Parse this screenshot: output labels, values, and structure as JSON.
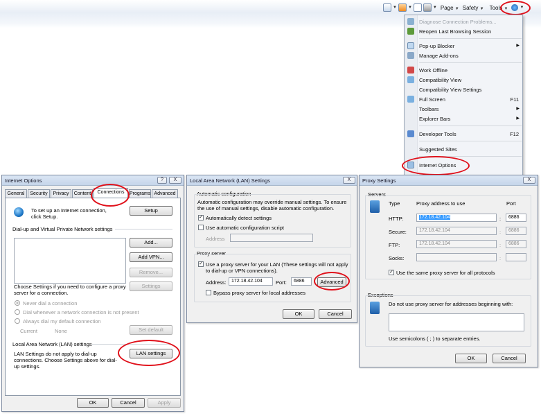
{
  "toolbar": {
    "page_label": "Page",
    "safety_label": "Safety",
    "tools_label": "Tools"
  },
  "tools_menu": {
    "items": [
      {
        "label": "Diagnose Connection Problems...",
        "disabled": true
      },
      {
        "label": "Reopen Last Browsing Session"
      },
      {
        "label": "Pop-up Blocker",
        "submenu": true
      },
      {
        "label": "Manage Add-ons"
      },
      {
        "label": "Work Offline"
      },
      {
        "label": "Compatibility View"
      },
      {
        "label": "Compatibility View Settings"
      },
      {
        "label": "Full Screen",
        "shortcut": "F11"
      },
      {
        "label": "Toolbars",
        "submenu": true
      },
      {
        "label": "Explorer Bars",
        "submenu": true
      },
      {
        "label": "Developer Tools",
        "shortcut": "F12"
      },
      {
        "label": "Suggested Sites"
      },
      {
        "label": "Internet Options"
      }
    ]
  },
  "internet_options": {
    "title": "Internet Options",
    "help_btn": "?",
    "close_btn": "X",
    "tabs": [
      "General",
      "Security",
      "Privacy",
      "Content",
      "Connections",
      "Programs",
      "Advanced"
    ],
    "setup_text": "To set up an Internet connection, click Setup.",
    "setup_button": "Setup",
    "dialup_heading": "Dial-up and Virtual Private Network settings",
    "add_button": "Add...",
    "add_vpn_button": "Add VPN...",
    "remove_button": "Remove...",
    "proxy_hint": "Choose Settings if you need to configure a proxy server for a connection.",
    "settings_button": "Settings",
    "radio_never": "Never dial a connection",
    "radio_whenever": "Dial whenever a network connection is not present",
    "radio_always": "Always dial my default connection",
    "current_label": "Current",
    "current_value": "None",
    "set_default_button": "Set default",
    "lan_heading": "Local Area Network (LAN) settings",
    "lan_text": "LAN Settings do not apply to dial-up connections. Choose Settings above for dial-up settings.",
    "lan_button": "LAN settings",
    "ok": "OK",
    "cancel": "Cancel",
    "apply": "Apply"
  },
  "lan_settings": {
    "title": "Local Area Network (LAN) Settings",
    "close_btn": "X",
    "auto_config_heading": "Automatic configuration",
    "auto_config_text": "Automatic configuration may override manual settings. To ensure the use of manual settings, disable automatic configuration.",
    "auto_detect_label": "Automatically detect settings",
    "auto_detect_checked": true,
    "use_script_label": "Use automatic configuration script",
    "use_script_checked": false,
    "address_label": "Address",
    "proxy_heading": "Proxy server",
    "use_proxy_label": "Use a proxy server for your LAN (These settings will not apply to dial-up or VPN connections).",
    "use_proxy_checked": true,
    "proxy_address_label": "Address:",
    "proxy_address_value": "172.18.42.104",
    "port_label": "Port:",
    "port_value": "6886",
    "advanced_button": "Advanced",
    "bypass_label": "Bypass proxy server for local addresses",
    "bypass_checked": false,
    "ok": "OK",
    "cancel": "Cancel"
  },
  "proxy_settings": {
    "title": "Proxy Settings",
    "close_btn": "X",
    "servers_heading": "Servers",
    "col_type": "Type",
    "col_address": "Proxy address to use",
    "col_port": "Port",
    "rows": [
      {
        "type": "HTTP:",
        "address": "172.18.42.104",
        "port": "6886"
      },
      {
        "type": "Secure:",
        "address": "172.18.42.104",
        "port": "6886"
      },
      {
        "type": "FTP:",
        "address": "172.18.42.104",
        "port": "6886"
      },
      {
        "type": "Socks:",
        "address": "",
        "port": ""
      }
    ],
    "colon": ":",
    "same_proxy_label": "Use the same proxy server for all protocols",
    "same_proxy_checked": true,
    "exceptions_heading": "Exceptions",
    "exceptions_text": "Do not use proxy server for addresses beginning with:",
    "semicolon_hint": "Use semicolons ( ; ) to separate entries.",
    "ok": "OK",
    "cancel": "Cancel"
  }
}
